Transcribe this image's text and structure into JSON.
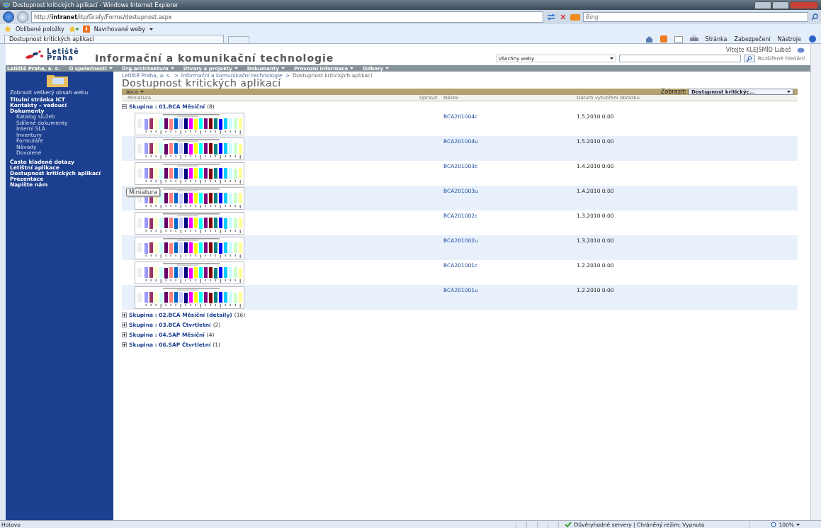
{
  "window": {
    "title": "Dostupnost kritických aplikací - Windows Internet Explorer"
  },
  "browser": {
    "address_prefix": "http://",
    "address_host": "intranet",
    "address_path": "/itp/Grafy/Forms/dostupnost.aspx",
    "search_placeholder": "Bing",
    "favorites": "Oblíbené položky",
    "suggested": "Navrhované weby",
    "tab": "Dostupnost kritických aplikací",
    "commands": [
      "Stránka",
      "Zabezpečení",
      "Nástroje"
    ]
  },
  "site": {
    "logo": [
      "Letiště",
      "Praha"
    ],
    "title": "Informační a komunikační technologie",
    "welcome": "Vítejte KLEJŠMÍD Luboš",
    "scope": "Všechny weby",
    "advanced": "Rozšířené hledání"
  },
  "topnav": [
    {
      "label": "Letiště Praha, a. s.",
      "menu": false
    },
    {
      "label": "O společnosti",
      "menu": true
    },
    {
      "label": "Org.architektura",
      "menu": true
    },
    {
      "label": "Útvary a projekty",
      "menu": true
    },
    {
      "label": "Dokumenty",
      "menu": true
    },
    {
      "label": "Provozní informace",
      "menu": true
    },
    {
      "label": "Odbory",
      "menu": true
    }
  ],
  "sidebar": {
    "view_all": "Zobrazit veškerý obsah webu",
    "items": [
      {
        "label": "Titulní stránka ICT"
      },
      {
        "label": "Kontakty – vedoucí"
      },
      {
        "label": "Dokumenty",
        "children": [
          {
            "label": "Katalog služeb"
          },
          {
            "label": "Sdílené dokumenty"
          },
          {
            "label": "Interní SLA"
          },
          {
            "label": "Inventury"
          },
          {
            "label": "Formuláře"
          },
          {
            "label": "Návody"
          },
          {
            "label": "Dovolené"
          }
        ]
      },
      {
        "label": "Často kladené dotazy"
      },
      {
        "label": "Letištní aplikace"
      },
      {
        "label": "Dostupnost kritických aplikací"
      },
      {
        "label": "Prezentace"
      },
      {
        "label": "Napište nám"
      }
    ]
  },
  "breadcrumb": {
    "separator": ">",
    "items": [
      "Letiště Praha, a. s.",
      "Informační a komunikační technologie",
      "Dostupnost kritických aplikací"
    ]
  },
  "page_title": "Dostupnost kritických aplikací",
  "toolbar": {
    "actions": "Akce",
    "view_label": "Zobrazit:",
    "view_value": "Dostupnost kritickýc..."
  },
  "columns": [
    "Miniatura",
    "Upravit",
    "Název",
    "Datum vytvoření obrázku"
  ],
  "groups": [
    {
      "label": "Skupina : 01.BCA Měsíční",
      "count": "(8)",
      "expanded": true,
      "rows": [
        {
          "name": "BCA201004c",
          "date": "1.5.2010 0:00"
        },
        {
          "name": "BCA201004u",
          "date": "1.5.2010 0:00"
        },
        {
          "name": "BCA201003c",
          "date": "1.4.2010 0:00"
        },
        {
          "name": "BCA201003u",
          "date": "1.4.2010 0:00"
        },
        {
          "name": "BCA201002c",
          "date": "1.3.2010 0:00"
        },
        {
          "name": "BCA201002u",
          "date": "1.3.2010 0:00"
        },
        {
          "name": "BCA201001c",
          "date": "1.2.2010 0:00"
        },
        {
          "name": "BCA201001u",
          "date": "1.2.2010 0:00"
        }
      ]
    },
    {
      "label": "Skupina : 02.BCA Měsíční (detaily)",
      "count": "(16)",
      "expanded": false
    },
    {
      "label": "Skupina : 03.BCA Čtvrtletní",
      "count": "(2)",
      "expanded": false
    },
    {
      "label": "Skupina : 04.SAP Měsíční",
      "count": "(4)",
      "expanded": false
    },
    {
      "label": "Skupina : 06.SAP Čtvrtletní",
      "count": "(1)",
      "expanded": false
    }
  ],
  "tooltip": "Miniatura",
  "status_bar": {
    "text": "Hotovo",
    "security": "Důvěryhodné servery | Chráněný režim: Vypnuto",
    "zoom": "100%"
  }
}
